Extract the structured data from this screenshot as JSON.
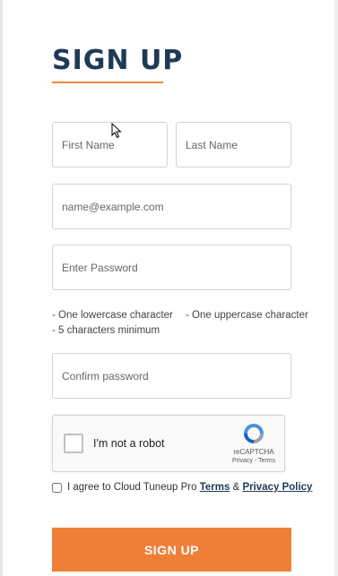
{
  "form": {
    "title": "SIGN UP",
    "first_name_placeholder": "First Name",
    "last_name_placeholder": "Last Name",
    "email_placeholder": "name@example.com",
    "password_placeholder": "Enter Password",
    "confirm_placeholder": "Confirm password",
    "password_rules": [
      "- One lowercase character",
      "- One uppercase character",
      "- 5 characters minimum"
    ],
    "submit_label": "SIGN UP"
  },
  "captcha": {
    "label": "I'm not a robot",
    "brand": "reCAPTCHA",
    "links": "Privacy - Terms"
  },
  "agree": {
    "prefix": "I agree to Cloud Tuneup Pro",
    "terms": "Terms",
    "amp": "&",
    "privacy": "Privacy Policy"
  },
  "colors": {
    "title": "#1e3a56",
    "accent": "#ef7f36",
    "underline": "#e98a3a"
  }
}
